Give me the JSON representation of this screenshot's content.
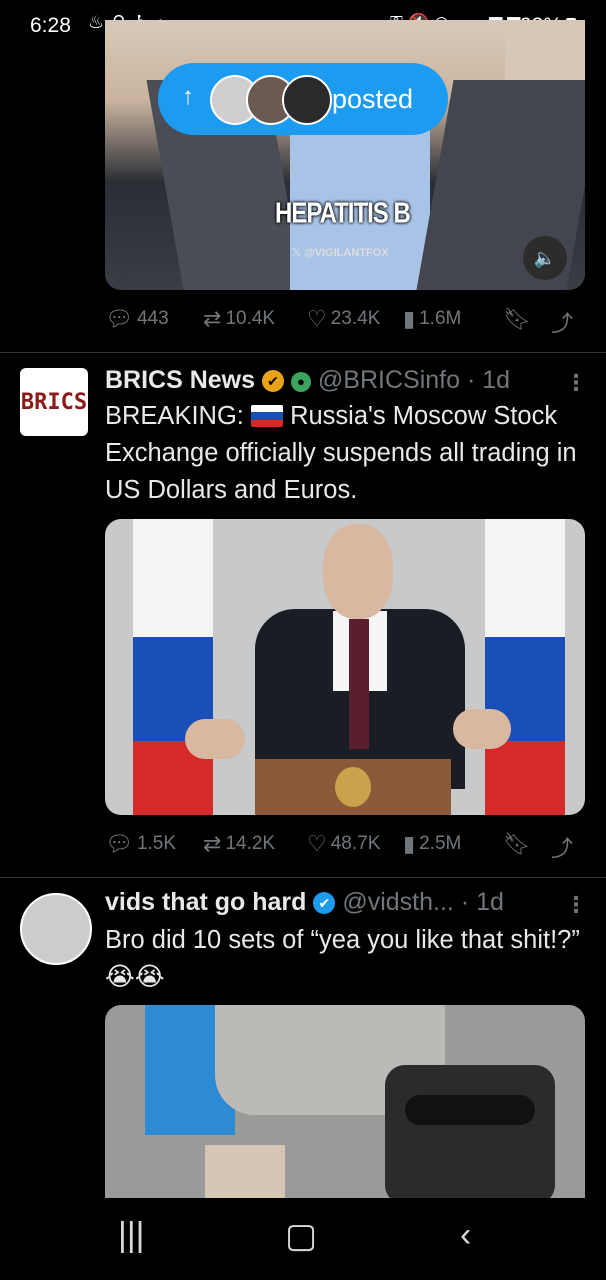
{
  "status_bar": {
    "time": "6:28",
    "battery": "93%",
    "left_icons": [
      "notification-icon",
      "location-icon",
      "accessibility-icon",
      "dot-icon"
    ],
    "right_icons": [
      "key-icon",
      "mute-icon",
      "wifi-icon",
      "signal-icon",
      "signal-r-icon"
    ]
  },
  "posts": [
    {
      "media_caption": "HEPATITIS B",
      "watermark": "@VIGILANTFOX",
      "actions": {
        "replies": "443",
        "reposts": "10.4K",
        "likes": "23.4K",
        "views": "1.6M"
      }
    },
    {
      "name": "BRICS News",
      "handle": "@BRICSinfo",
      "time": "· 1d",
      "avatar_text": "BRICS",
      "text_prefix": "BREAKING:",
      "text_rest": "Russia's Moscow Stock Exchange officially suspends all trading in US Dollars and Euros.",
      "actions": {
        "replies": "1.5K",
        "reposts": "14.2K",
        "likes": "48.7K",
        "views": "2.5M"
      }
    },
    {
      "name": "vids that go hard",
      "handle": "@vidsth...",
      "time": "· 1d",
      "text": "Bro did 10 sets of “yea you like that shit!?”",
      "emoji": "😭😭"
    }
  ],
  "posted_pill": {
    "label": "posted"
  },
  "colors": {
    "accent": "#1d9bf0",
    "muted": "#71767b",
    "background": "#000000"
  },
  "nav_bar": [
    "recents-icon",
    "home-icon",
    "back-icon"
  ]
}
